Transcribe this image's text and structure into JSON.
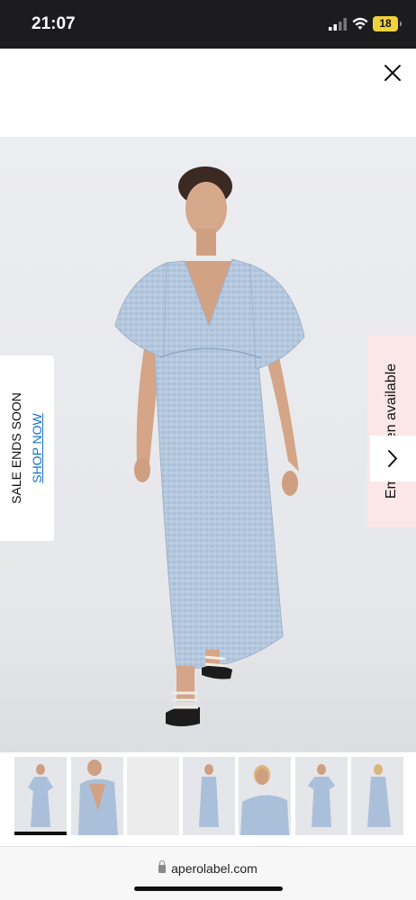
{
  "status_bar": {
    "time": "21:07",
    "battery": "18"
  },
  "hero": {
    "email_cta": "Email when available"
  },
  "sale_banner": {
    "title": "SALE ENDS SOON",
    "link": "SHOP NOW"
  },
  "thumbnails": [
    {
      "active": true
    },
    {
      "active": false
    },
    {
      "active": false
    },
    {
      "active": false
    },
    {
      "active": false
    },
    {
      "active": false
    },
    {
      "active": false
    }
  ],
  "browser": {
    "url": "aperolabel.com"
  },
  "colors": {
    "dress": "#a9bfd9",
    "email_tab_bg": "#fbe6e8",
    "link": "#1a73c8"
  }
}
